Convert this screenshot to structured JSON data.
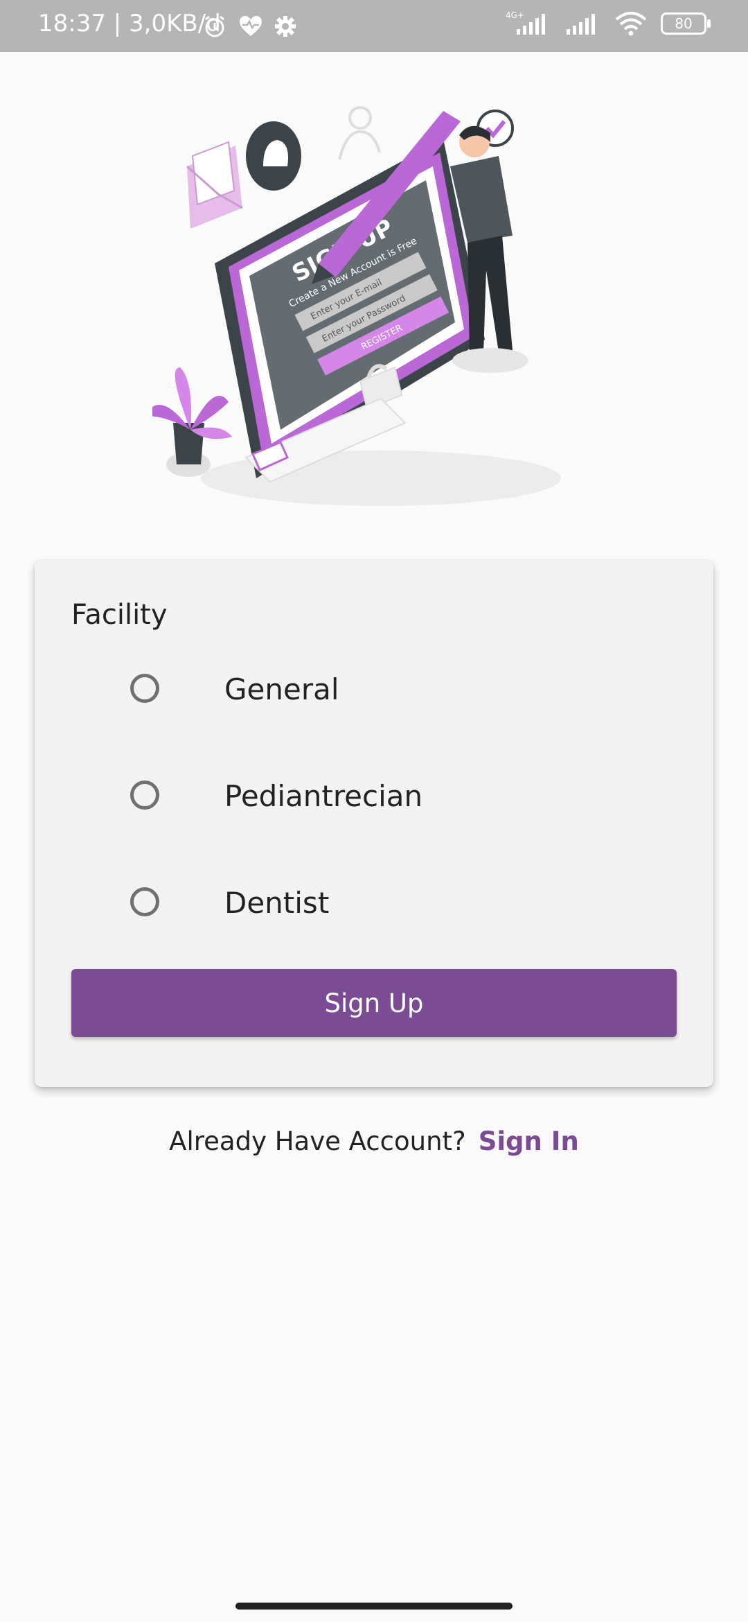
{
  "status_bar": {
    "time": "18:37 | 3,0KB/d",
    "network_label": "4G+",
    "battery": "80",
    "icons": [
      "alarm-icon",
      "heart-icon",
      "gear-icon",
      "signal-icon",
      "signal-icon",
      "wifi-icon",
      "battery-icon"
    ]
  },
  "illustration": {
    "heading": "SIGN UP",
    "subheading": "Create a New Account is Free",
    "email_placeholder": "Enter your E-mail",
    "password_placeholder": "Enter your Password",
    "register_label": "REGISTER"
  },
  "form": {
    "title": "Facility",
    "options": [
      {
        "label": "General",
        "selected": false
      },
      {
        "label": "Pediantrecian",
        "selected": false
      },
      {
        "label": "Dentist",
        "selected": false
      }
    ],
    "submit_label": "Sign Up"
  },
  "footer": {
    "prompt": "Already Have Account?",
    "link": "Sign In"
  },
  "colors": {
    "accent": "#7b4b94",
    "illustration_purple": "#b968d6",
    "dark": "#3c444a",
    "status_bar": "#b5b5b5"
  }
}
